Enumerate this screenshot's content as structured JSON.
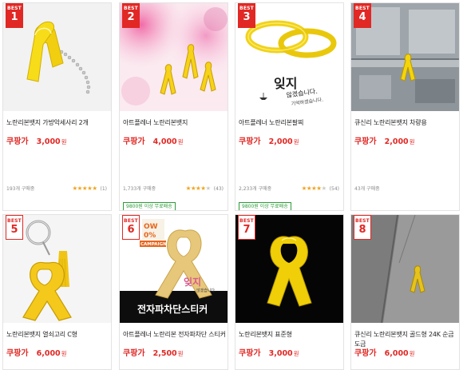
{
  "products": [
    {
      "rank": "1",
      "badge_text": "BEST",
      "name": "노란리본뱃지 가방악세사리 2개",
      "coupang_label": "쿠팡가",
      "price": "3,000",
      "won": "원",
      "sold": "193개 구매중",
      "stars": 5,
      "reviews": "(1)",
      "shipping": ""
    },
    {
      "rank": "2",
      "badge_text": "BEST",
      "name": "아트플레너 노란리본뱃지",
      "coupang_label": "쿠팡가",
      "price": "4,000",
      "won": "원",
      "sold": "1,733개 구매중",
      "stars": 4.5,
      "reviews": "(43)",
      "shipping": "9800원 이상 무료배송"
    },
    {
      "rank": "3",
      "badge_text": "BEST",
      "name": "아트플레너 노란리본팔찌",
      "coupang_label": "쿠팡가",
      "price": "2,000",
      "won": "원",
      "sold": "2,233개 구매중",
      "stars": 4.5,
      "reviews": "(54)",
      "shipping": "9800원 이상 무료배송"
    },
    {
      "rank": "4",
      "badge_text": "BEST",
      "name": "큐신리 노란리본뱃지 차량용",
      "coupang_label": "쿠팡가",
      "price": "2,000",
      "won": "원",
      "sold": "43개 구매중",
      "stars": 0,
      "reviews": "",
      "shipping": ""
    },
    {
      "rank": "5",
      "badge_text": "BEST",
      "name": "노란리본뱃지 열쇠고리 C형",
      "coupang_label": "쿠팡가",
      "price": "6,000",
      "won": "원",
      "sold": "",
      "stars": 0,
      "reviews": "",
      "shipping": ""
    },
    {
      "rank": "6",
      "badge_text": "BEST",
      "name": "아트플레너 노란리본 전자파차단 스티커",
      "coupang_label": "쿠팡가",
      "price": "2,500",
      "won": "원",
      "sold": "",
      "stars": 0,
      "reviews": "",
      "shipping": ""
    },
    {
      "rank": "7",
      "badge_text": "BEST",
      "name": "노란리본뱃지 표준형",
      "coupang_label": "쿠팡가",
      "price": "3,000",
      "won": "원",
      "sold": "",
      "stars": 0,
      "reviews": "",
      "shipping": ""
    },
    {
      "rank": "8",
      "badge_text": "BEST",
      "name": "큐신리 노란리본뱃지 골드형 24K 순금 도금",
      "coupang_label": "쿠팡가",
      "price": "6,000",
      "won": "원",
      "sold": "",
      "stars": 0,
      "reviews": "",
      "shipping": ""
    }
  ],
  "image_text": {
    "p3_line1": "잊지",
    "p3_line2": "않겠습니다.",
    "p3_line3": "기억하겠습니다.",
    "p6_promo1": "OW",
    "p6_promo2": "0%",
    "p6_campaign": "CAMPAIGN",
    "p6_script1": "잊지",
    "p6_script2": "않겠습니다.",
    "p6_banner": "전자파차단스티커"
  },
  "colors": {
    "accent_red": "#e12824",
    "ribbon_yellow": "#f5d40c",
    "star_orange": "#f0a520",
    "shipping_green": "#2c9a37"
  }
}
